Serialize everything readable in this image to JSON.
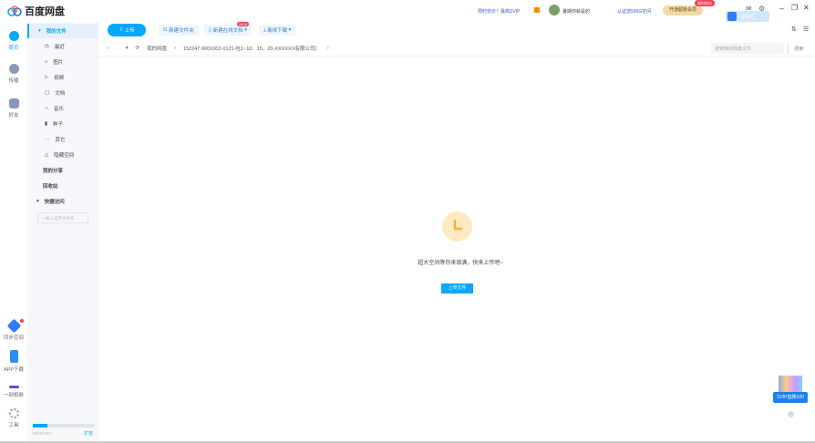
{
  "app": {
    "title": "百度网盘"
  },
  "header": {
    "promo": "限时低价！最高SVIP",
    "user": "暑期你就是的",
    "certify": "认证送500G空间",
    "vip_button": "开通超级会员",
    "vip_badge": "限时低价",
    "float_tag": "领福利"
  },
  "rail": [
    {
      "label": "首页"
    },
    {
      "label": "传输"
    },
    {
      "label": "好友"
    },
    {
      "label": "同步空间"
    },
    {
      "label": "APP下载"
    },
    {
      "label": "一刻相册"
    },
    {
      "label": "工具"
    }
  ],
  "sidebar": {
    "items": [
      {
        "label": "我的文件"
      },
      {
        "label": "最近"
      },
      {
        "label": "图片"
      },
      {
        "label": "视频"
      },
      {
        "label": "文档"
      },
      {
        "label": "音乐"
      },
      {
        "label": "种子"
      },
      {
        "label": "其它"
      },
      {
        "label": "隐藏空间"
      },
      {
        "label": "我的分享"
      },
      {
        "label": "回收站"
      },
      {
        "label": "快捷访问"
      }
    ],
    "drop_hint": "+ 拖入常用文件夹",
    "storage": "5G/2048G",
    "expand": "扩容",
    "storage_percent": 23
  },
  "toolbar": {
    "upload": "上传",
    "new_folder": "新建文件夹",
    "new_online_doc": "新建在线文档",
    "new_badge": "NEW",
    "offline_download": "离线下载"
  },
  "path": {
    "root": "我的网盘",
    "folder": "152247-9001002-0121-包1~10、15、20-XXXXXX有限公司）"
  },
  "search": {
    "placeholder": "搜索我的网盘文件",
    "button": "搜索"
  },
  "empty": {
    "message": "超大空间等你来填满，快来上传吧~",
    "button": "上传文件"
  },
  "promo_float": {
    "label": "SVIP直降100"
  }
}
